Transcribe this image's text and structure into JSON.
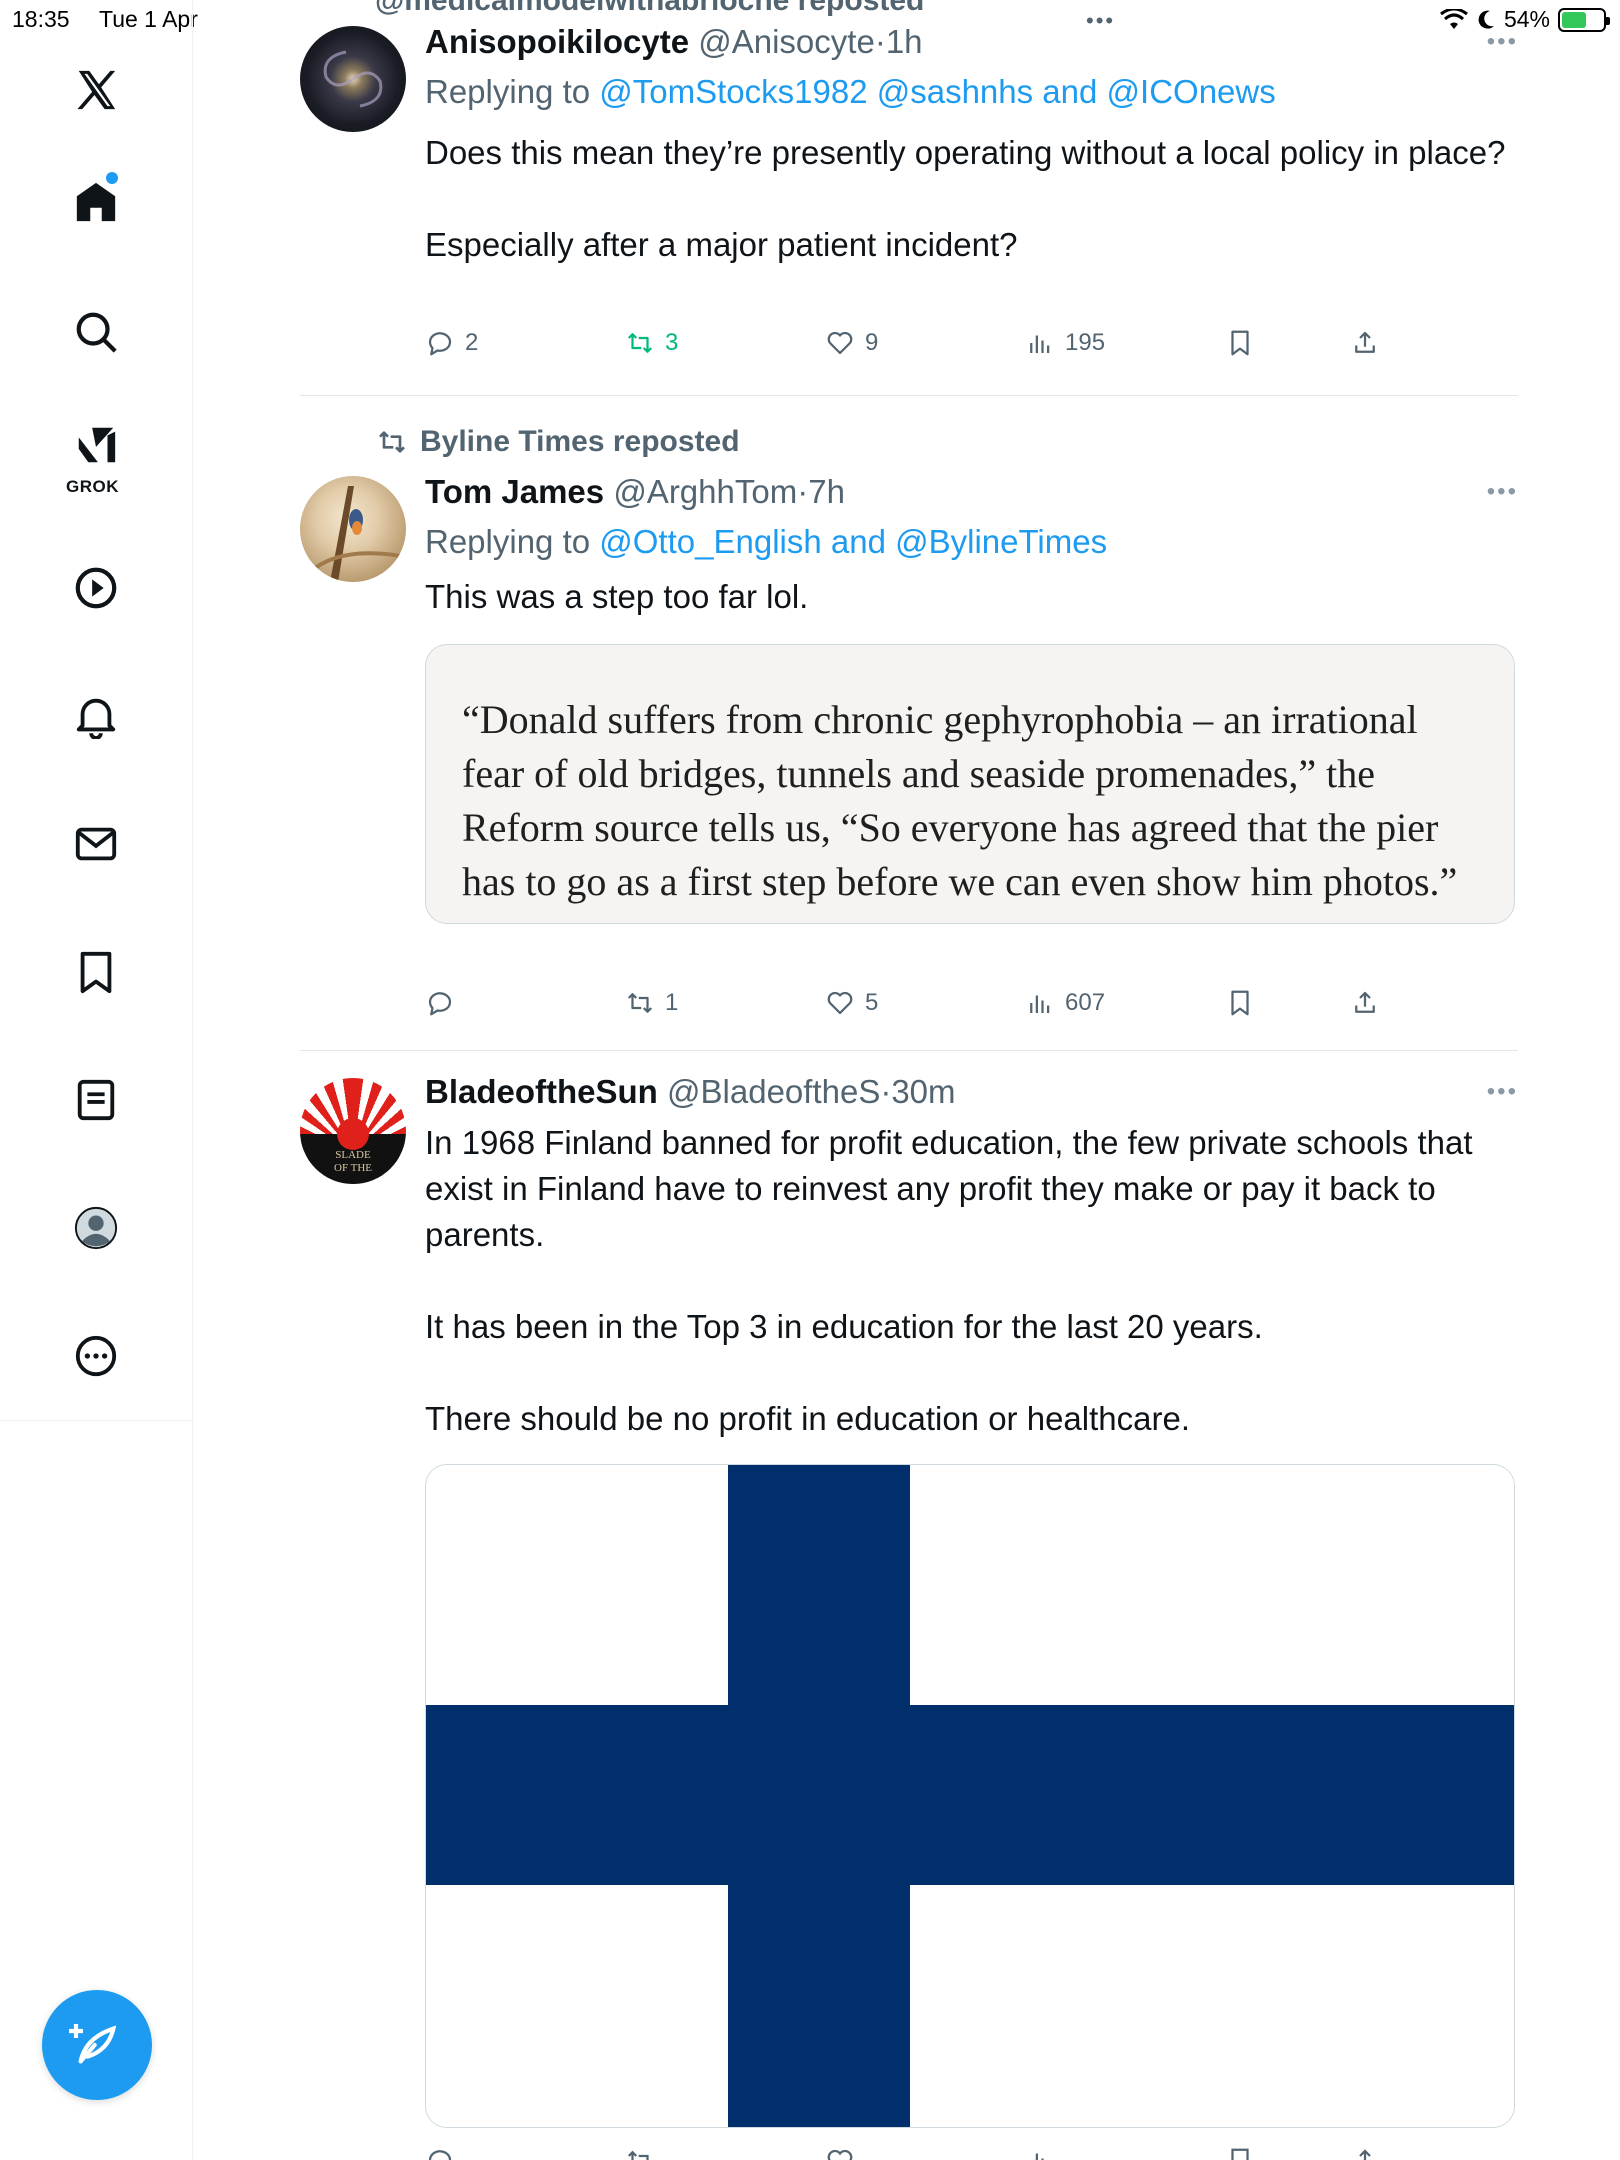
{
  "status_bar": {
    "time": "18:35",
    "date": "Tue 1 Apr",
    "battery": "54%"
  },
  "sidebar": {
    "items": [
      {
        "name": "x-logo"
      },
      {
        "name": "home"
      },
      {
        "name": "search"
      },
      {
        "name": "grok",
        "label": "GROK"
      },
      {
        "name": "video"
      },
      {
        "name": "notifications"
      },
      {
        "name": "messages"
      },
      {
        "name": "bookmarks"
      },
      {
        "name": "lists"
      },
      {
        "name": "profile"
      },
      {
        "name": "more"
      }
    ]
  },
  "timeline": {
    "top_cut_text": "@medicalmodelwithabrioche reposted",
    "posts": [
      {
        "name": "Anisopoikilocyte",
        "handle": "@Anisocyte",
        "dot": "·",
        "time": "1h",
        "reply_prefix": "Replying to ",
        "reply_to": "@TomStocks1982 @sashnhs and @ICOnews",
        "text": "Does this mean they’re presently operating without a local policy in place?\n\nEspecially after a major patient incident?",
        "replies": "2",
        "reposts": "3",
        "likes": "9",
        "views": "195"
      },
      {
        "reposted_by": "Byline Times reposted",
        "name": "Tom James",
        "handle": "@ArghhTom",
        "dot": "·",
        "time": "7h",
        "reply_prefix": "Replying to ",
        "reply_to": "@Otto_English and @BylineTimes",
        "text": "This was a step too far lol.",
        "quote": "“Donald suffers from chronic gephyrophobia – an irrational fear of old bridges, tunnels and seaside promenades,” the Reform source tells us, “So everyone has agreed that the pier has to go as a first step before we can even show him photos.”",
        "replies": "",
        "reposts": "1",
        "likes": "5",
        "views": "607"
      },
      {
        "name": "BladeoftheSun",
        "handle": "@BladeoftheS",
        "dot": "·",
        "time": "30m",
        "text": "In 1968 Finland banned for profit education, the few private schools that exist in Finland have to reinvest any profit they make or pay it back to parents.\n\nIt has been in the Top 3 in education for the last 20 years.\n\nThere should be no profit in education or healthcare.",
        "image": "finland-flag",
        "flag_colors": {
          "cross": "#002f6c",
          "field": "#ffffff"
        }
      }
    ]
  },
  "colors": {
    "accent": "#1d9bf0",
    "retweet_green": "#00ba7c",
    "secondary_text": "#536471"
  }
}
